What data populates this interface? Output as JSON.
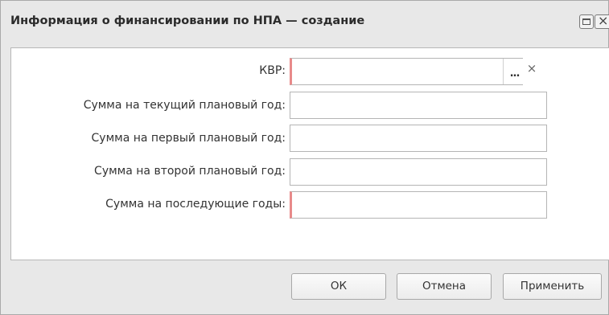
{
  "dialog": {
    "title": "Информация о финансировании по НПА — создание"
  },
  "form": {
    "kvr": {
      "label": "КВР:",
      "value": "",
      "required": true
    },
    "sum_current": {
      "label": "Сумма на текущий плановый год:",
      "value": ""
    },
    "sum_first": {
      "label": "Сумма на первый плановый год:",
      "value": ""
    },
    "sum_second": {
      "label": "Сумма на второй плановый год:",
      "value": ""
    },
    "sum_later": {
      "label": "Сумма на последующие годы:",
      "value": "",
      "required": true
    }
  },
  "icons": {
    "ellipsis": "...",
    "clear": "×",
    "maximize": "maximize-icon",
    "close": "×"
  },
  "buttons": {
    "ok": "ОК",
    "cancel": "Отмена",
    "apply": "Применить"
  },
  "colors": {
    "required_marker": "#e88a8a",
    "dialog_bg": "#e8e8e8"
  }
}
